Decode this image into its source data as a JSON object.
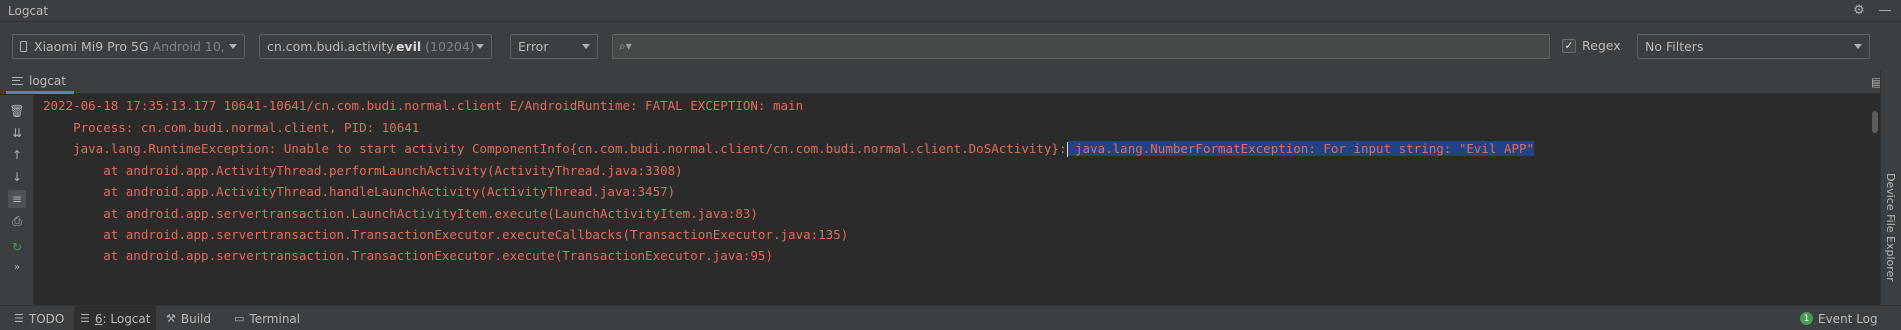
{
  "window": {
    "title": "Logcat"
  },
  "toolbar": {
    "device": {
      "name": "Xiaomi Mi9 Pro 5G",
      "os": "Android 10,"
    },
    "process": {
      "prefix": "cn.com.budi.activity.",
      "bold": "evil",
      "pid": "(10204)"
    },
    "level": "Error",
    "search": {
      "value": "",
      "placeholder": ""
    },
    "regex": {
      "label": "Regex",
      "checked": true
    },
    "filter": "No Filters"
  },
  "tabs": [
    {
      "label": "logcat"
    }
  ],
  "log": {
    "lines": [
      "2022-06-18 17:35:13.177 10641-10641/cn.com.budi.normal.client E/AndroidRuntime: FATAL EXCEPTION: main",
      "    Process: cn.com.budi.normal.client, PID: 10641",
      "    java.lang.RuntimeException: Unable to start activity ComponentInfo{cn.com.budi.normal.client/cn.com.budi.normal.client.DoSActivity}:",
      "        at android.app.ActivityThread.performLaunchActivity(ActivityThread.java:3308)",
      "        at android.app.ActivityThread.handleLaunchActivity(ActivityThread.java:3457)",
      "        at android.app.servertransaction.LaunchActivityItem.execute(LaunchActivityItem.java:83)",
      "        at android.app.servertransaction.TransactionExecutor.executeCallbacks(TransactionExecutor.java:135)",
      "        at android.app.servertransaction.TransactionExecutor.execute(TransactionExecutor.java:95)"
    ],
    "selected_text": " java.lang.NumberFormatException: For input string: \"Evil APP\""
  },
  "right_panel": {
    "label": "Device File Explorer"
  },
  "status_bar": {
    "todo": "TODO",
    "logcat_num": "6",
    "logcat_label": ": Logcat",
    "build": "Build",
    "terminal": "Terminal",
    "event_log": "Event Log",
    "event_count": "1"
  },
  "colors": {
    "error_text": "#e06c5a",
    "selection": "#214283",
    "background": "#2b2b2b",
    "panel": "#3c3f41"
  }
}
